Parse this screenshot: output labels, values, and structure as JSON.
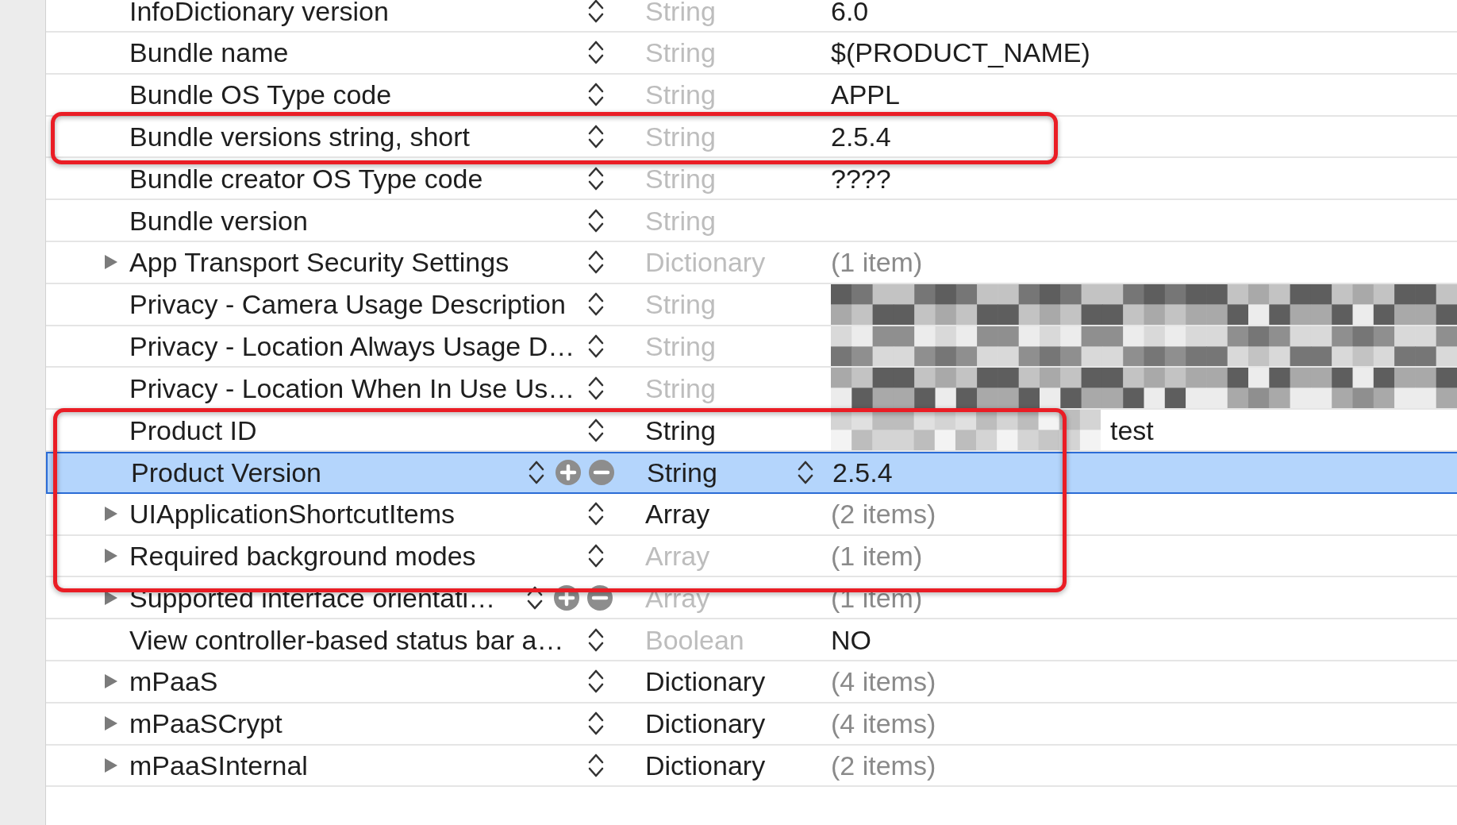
{
  "rows": [
    {
      "key": "InfoDictionary version",
      "kind": "leaf",
      "type": "String",
      "type_dimmed": true,
      "value": "6.0",
      "value_redacted": false,
      "selected": false,
      "controls_visible": false
    },
    {
      "key": "Bundle name",
      "kind": "leaf",
      "type": "String",
      "type_dimmed": true,
      "value": "$(PRODUCT_NAME)",
      "value_redacted": false,
      "selected": false,
      "controls_visible": false
    },
    {
      "key": "Bundle OS Type code",
      "kind": "leaf",
      "type": "String",
      "type_dimmed": true,
      "value": "APPL",
      "value_redacted": false,
      "selected": false,
      "controls_visible": false
    },
    {
      "key": "Bundle versions string, short",
      "kind": "leaf",
      "type": "String",
      "type_dimmed": true,
      "value": "2.5.4",
      "value_redacted": false,
      "selected": false,
      "controls_visible": false
    },
    {
      "key": "Bundle creator OS Type code",
      "kind": "leaf",
      "type": "String",
      "type_dimmed": true,
      "value": "????",
      "value_redacted": false,
      "selected": false,
      "controls_visible": false
    },
    {
      "key": "Bundle version",
      "kind": "leaf",
      "type": "String",
      "type_dimmed": true,
      "value_redacted": false,
      "selected": false,
      "controls_visible": false
    },
    {
      "key": "App Transport Security Settings",
      "kind": "container",
      "expanded": false,
      "type": "Dictionary",
      "type_dimmed": true,
      "value": "(1 item)",
      "value_redacted": false,
      "selected": false,
      "controls_visible": false
    },
    {
      "key": "Privacy - Camera Usage Description",
      "kind": "leaf",
      "type": "String",
      "type_dimmed": true,
      "value_redacted": true,
      "selected": false,
      "controls_visible": false
    },
    {
      "key": "Privacy - Location Always Usage D…",
      "kind": "leaf",
      "type": "String",
      "type_dimmed": true,
      "value_redacted": true,
      "selected": false,
      "controls_visible": false
    },
    {
      "key": "Privacy - Location When In Use Us…",
      "kind": "leaf",
      "type": "String",
      "type_dimmed": true,
      "value_redacted": true,
      "selected": false,
      "controls_visible": false
    },
    {
      "key": "Product ID",
      "kind": "leaf",
      "type": "String",
      "type_dimmed": false,
      "value": "test",
      "value_redacted": true,
      "selected": false,
      "controls_visible": false
    },
    {
      "key": "Product Version",
      "kind": "leaf",
      "type": "String",
      "type_dimmed": false,
      "value": "2.5.4",
      "value_redacted": false,
      "selected": true,
      "controls_visible": true
    },
    {
      "key": "UIApplicationShortcutItems",
      "kind": "container",
      "expanded": false,
      "type": "Array",
      "type_dimmed": false,
      "value": "(2 items)",
      "value_redacted": false,
      "selected": false,
      "controls_visible": false
    },
    {
      "key": "Required background modes",
      "kind": "container",
      "expanded": false,
      "type": "Array",
      "type_dimmed": true,
      "value": "(1 item)",
      "value_redacted": false,
      "selected": false,
      "controls_visible": false
    },
    {
      "key": "Supported interface orientati…",
      "kind": "container",
      "expanded": false,
      "type": "Array",
      "type_dimmed": true,
      "value": "(1 item)",
      "value_redacted": false,
      "selected": false,
      "controls_visible": true
    },
    {
      "key": "View controller-based status bar a…",
      "kind": "leaf",
      "type": "Boolean",
      "type_dimmed": true,
      "value": "NO",
      "value_redacted": false,
      "selected": false,
      "controls_visible": false
    },
    {
      "key": "mPaaS",
      "kind": "container",
      "expanded": false,
      "type": "Dictionary",
      "type_dimmed": false,
      "value": "(4 items)",
      "value_redacted": false,
      "selected": false,
      "controls_visible": false
    },
    {
      "key": "mPaaSCrypt",
      "kind": "container",
      "expanded": false,
      "type": "Dictionary",
      "type_dimmed": false,
      "value": "(4 items)",
      "value_redacted": false,
      "selected": false,
      "controls_visible": false
    },
    {
      "key": "mPaaSInternal",
      "kind": "container",
      "expanded": false,
      "type": "Dictionary",
      "type_dimmed": false,
      "value": "(2 items)",
      "value_redacted": false,
      "selected": false,
      "controls_visible": false
    }
  ],
  "annotations": [
    {
      "kind": "outline"
    },
    {
      "kind": "outline"
    }
  ]
}
